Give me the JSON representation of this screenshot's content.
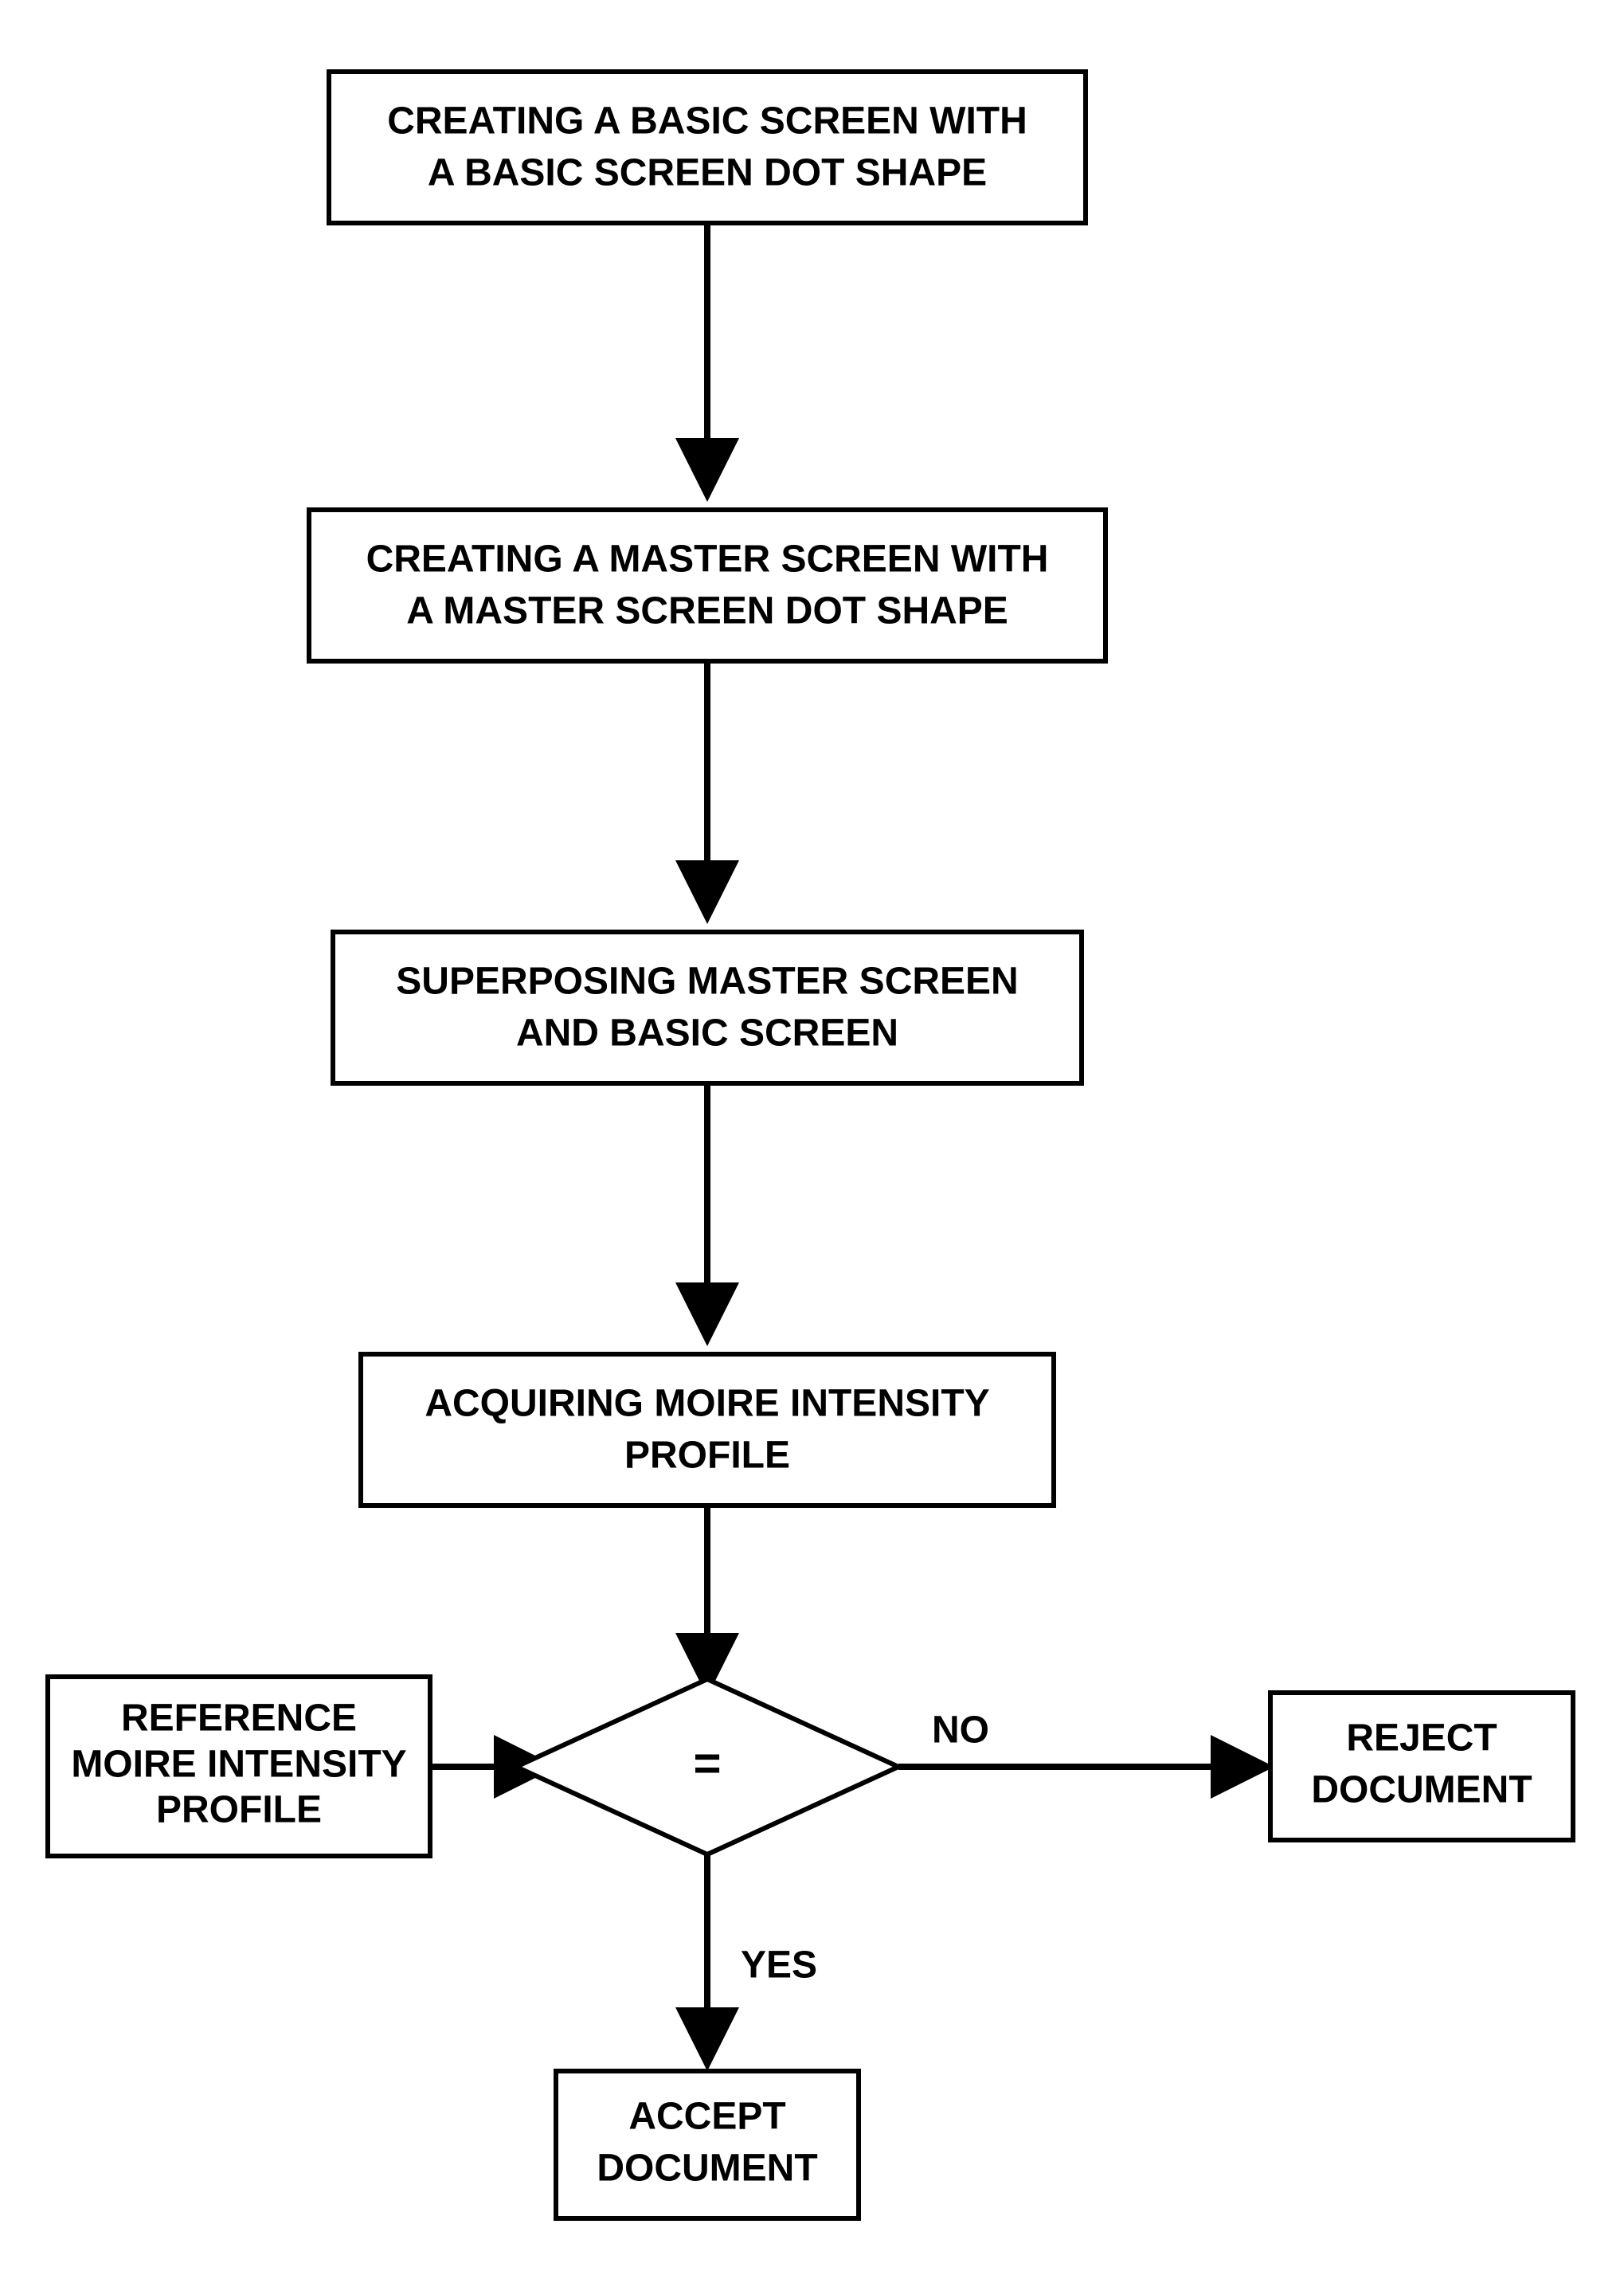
{
  "flowchart": {
    "nodes": {
      "step1": {
        "line1": "CREATING A BASIC SCREEN WITH",
        "line2": "A BASIC SCREEN DOT SHAPE"
      },
      "step2": {
        "line1": "CREATING A MASTER SCREEN WITH",
        "line2": "A MASTER SCREEN DOT SHAPE"
      },
      "step3": {
        "line1": "SUPERPOSING MASTER SCREEN",
        "line2": "AND BASIC SCREEN"
      },
      "step4": {
        "line1": "ACQUIRING MOIRE INTENSITY",
        "line2": "PROFILE"
      },
      "ref": {
        "line1": "REFERENCE",
        "line2": "MOIRE INTENSITY",
        "line3": "PROFILE"
      },
      "decision": {
        "symbol": "="
      },
      "reject": {
        "line1": "REJECT",
        "line2": "DOCUMENT"
      },
      "accept": {
        "line1": "ACCEPT",
        "line2": "DOCUMENT"
      }
    },
    "edgeLabels": {
      "no": "NO",
      "yes": "YES"
    }
  }
}
